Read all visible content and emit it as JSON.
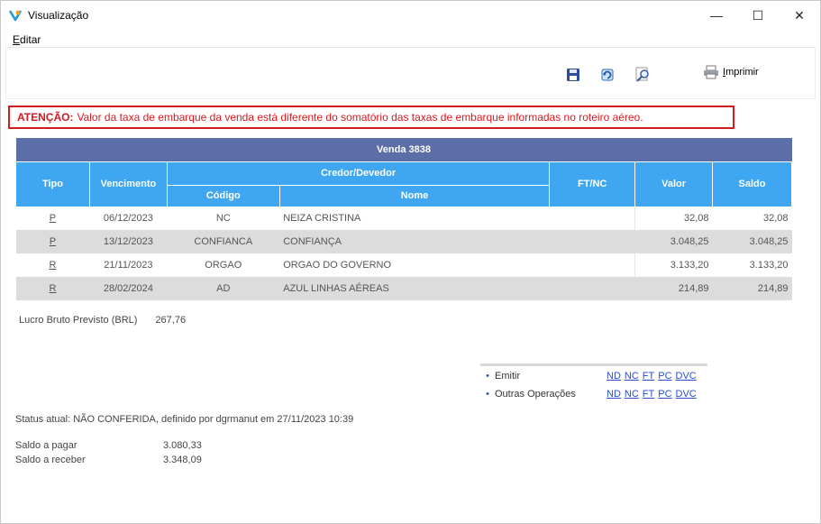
{
  "window": {
    "title": "Visualização",
    "controls": {
      "minimize": "—",
      "maximize": "☐",
      "close": "✕"
    }
  },
  "menu": {
    "editar_mnemonic": "E",
    "editar_rest": "ditar"
  },
  "toolbar": {
    "print_mnemonic": "I",
    "print_rest": "mprimir"
  },
  "warning": {
    "prefix": "ATENÇÃO:",
    "text": "Valor da taxa de embarque da venda está diferente do somatório das taxas de embarque informadas no roteiro aéreo."
  },
  "table": {
    "title": "Venda 3838",
    "headers": {
      "tipo": "Tipo",
      "vencimento": "Vencimento",
      "credor_devedor": "Credor/Devedor",
      "codigo": "Código",
      "nome": "Nome",
      "ftnc": "FT/NC",
      "valor": "Valor",
      "saldo": "Saldo"
    },
    "rows": [
      {
        "tipo": "P",
        "vencimento": "06/12/2023",
        "codigo": "NC",
        "nome": "NEIZA CRISTINA",
        "ftnc": "",
        "valor": "32,08",
        "saldo": "32,08"
      },
      {
        "tipo": "P",
        "vencimento": "13/12/2023",
        "codigo": "CONFIANCA",
        "nome": "CONFIANÇA",
        "ftnc": "",
        "valor": "3.048,25",
        "saldo": "3.048,25"
      },
      {
        "tipo": "R",
        "vencimento": "21/11/2023",
        "codigo": "ORGAO",
        "nome": "ORGAO DO GOVERNO",
        "ftnc": "",
        "valor": "3.133,20",
        "saldo": "3.133,20"
      },
      {
        "tipo": "R",
        "vencimento": "28/02/2024",
        "codigo": "AD",
        "nome": "AZUL LINHAS AÉREAS",
        "ftnc": "",
        "valor": "214,89",
        "saldo": "214,89"
      }
    ]
  },
  "lucro": {
    "label": "Lucro Bruto Previsto (BRL)",
    "value": "267,76"
  },
  "operations": {
    "bullet": "•",
    "rows": [
      {
        "label": "Emitir",
        "links": [
          "ND",
          "NC",
          "FT",
          "PC",
          "DVC"
        ]
      },
      {
        "label": "Outras Operações",
        "links": [
          "ND",
          "NC",
          "FT",
          "PC",
          "DVC"
        ]
      }
    ]
  },
  "status": "Status atual: NÃO CONFERIDA, definido por dgrmanut em 27/11/2023 10:39",
  "saldos": [
    {
      "label": "Saldo a pagar",
      "value": "3.080,33"
    },
    {
      "label": "Saldo a receber",
      "value": "3.348,09"
    }
  ],
  "colors": {
    "warning_red": "#d71920",
    "header_blue": "#3fa6f1",
    "title_blue": "#5b6ea7",
    "row_gray": "#dcdcdc"
  }
}
